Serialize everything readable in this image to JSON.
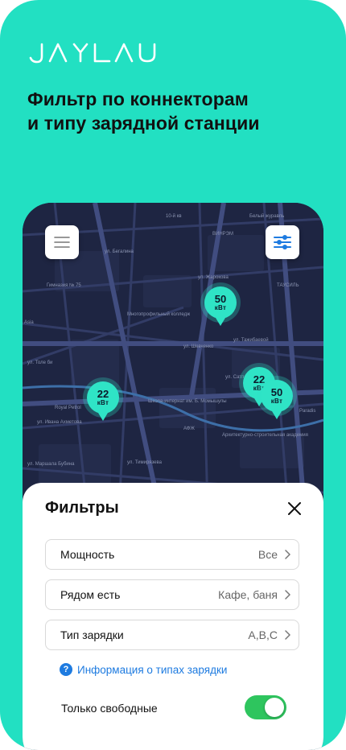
{
  "brand": {
    "logo_text": "JAYLAU"
  },
  "headline": {
    "line1": "Фильтр по коннекторам",
    "line2": "и типу зарядной станции"
  },
  "map": {
    "stations": [
      {
        "power": "50",
        "unit": "кВт"
      },
      {
        "power": "22",
        "unit": "кВт"
      },
      {
        "power": "22",
        "unit": "кВт"
      },
      {
        "power": "50",
        "unit": "кВт"
      }
    ],
    "labels": {
      "l1": "Белый журавль",
      "l2": "ВИНРЭМ",
      "l3": "ул. Бегалина",
      "l4": "Гимназия № 75",
      "l5": "Многопрофильный колледж",
      "l6": "ул. Жарокова",
      "l7": "ул. Шевченко",
      "l8": "ул. Толе би",
      "l9": "ул. Тимирязева",
      "l10": "Royal Petrol",
      "l11": "Школа-интернат им. Б. Момышулы",
      "l12": "АФЖ",
      "l13": "Архитектурно-строительная академия",
      "l14": "ул. Ивана Ахметова",
      "l15": "ул. Маршала Бубина",
      "l16": "ТАУСИЛЬ",
      "l17": "ул. Тажибаевой",
      "l18": "Asia",
      "l19": "Paradis",
      "l20": "10-й кв",
      "l21": "ул. Сатпаева"
    }
  },
  "filters": {
    "title": "Фильтры",
    "rows": [
      {
        "label": "Мощность",
        "value": "Все"
      },
      {
        "label": "Рядом есть",
        "value": "Кафе, баня"
      },
      {
        "label": "Тип зарядки",
        "value": "A,B,C"
      }
    ],
    "info_link": "Информация о типах зарядки",
    "free_only": {
      "label": "Только свободные",
      "on": true
    }
  },
  "colors": {
    "accent": "#22e0c2",
    "map_bg": "#1d2440",
    "toggle_on": "#2ec55e",
    "link": "#1e7be0"
  },
  "icons": [
    "menu-icon",
    "filter-sliders-icon",
    "close-icon",
    "chevron-right-icon",
    "question-icon"
  ]
}
